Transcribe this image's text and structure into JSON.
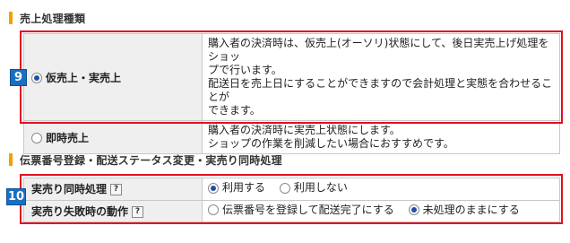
{
  "section1": {
    "title": "売上処理種類",
    "badge": "9",
    "options": [
      {
        "label": "仮売上・実売上",
        "selected": true,
        "desc_lines": [
          "購入者の決済時は、仮売上(オーソリ)状態にして、後日実売上げ処理をショッ",
          "プで行います。",
          "配送日を売上日にすることができますので会計処理と実態を合わせることが",
          "できます。"
        ]
      },
      {
        "label": "即時売上",
        "selected": false,
        "desc_lines": [
          "購入者の決済時に実売上状態にします。",
          "ショップの作業を削減したい場合におすすめです。"
        ]
      }
    ]
  },
  "section2": {
    "title": "伝票番号登録・配送ステータス変更・実売り同時処理",
    "badge": "10",
    "help_glyph": "?",
    "rows": [
      {
        "label": "実売り同時処理",
        "choices": [
          {
            "text": "利用する",
            "selected": true
          },
          {
            "text": "利用しない",
            "selected": false
          }
        ]
      },
      {
        "label": "実売り失敗時の動作",
        "choices": [
          {
            "text": "伝票番号を登録して配送完了にする",
            "selected": false
          },
          {
            "text": "未処理のままにする",
            "selected": true
          }
        ]
      }
    ]
  },
  "colors": {
    "accent_bar": "#f3a000",
    "highlight_border": "#e01020",
    "badge": "#1a6fc2"
  }
}
